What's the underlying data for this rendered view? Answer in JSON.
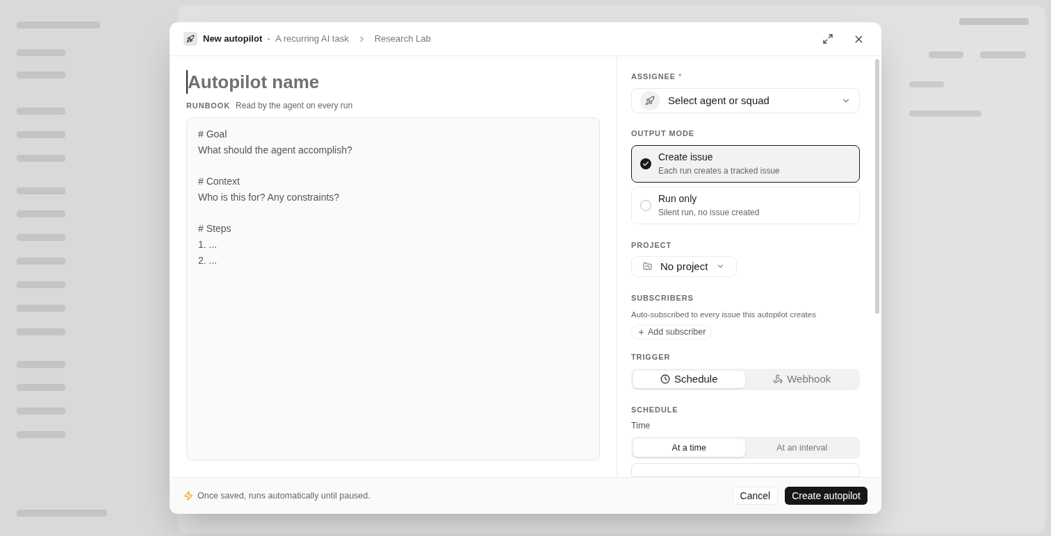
{
  "dialog": {
    "title": "New autopilot",
    "subtitle": "A recurring AI task",
    "breadcrumb": "Research Lab"
  },
  "name_field": {
    "placeholder": "Autopilot name"
  },
  "runbook": {
    "label": "RUNBOOK",
    "hint": "Read by the agent on every run",
    "placeholder": "# Goal\nWhat should the agent accomplish?\n\n# Context\nWho is this for? Any constraints?\n\n# Steps\n1. ...\n2. ..."
  },
  "assignee": {
    "label": "ASSIGNEE",
    "required_mark": "*",
    "placeholder": "Select agent or squad"
  },
  "output_mode": {
    "label": "OUTPUT MODE",
    "options": [
      {
        "title": "Create issue",
        "description": "Each run creates a tracked issue",
        "selected": true
      },
      {
        "title": "Run only",
        "description": "Silent run, no issue created",
        "selected": false
      }
    ]
  },
  "project": {
    "label": "PROJECT",
    "value": "No project"
  },
  "subscribers": {
    "label": "SUBSCRIBERS",
    "description": "Auto-subscribed to every issue this autopilot creates",
    "add_button": "Add subscriber"
  },
  "trigger": {
    "label": "TRIGGER",
    "options": [
      {
        "label": "Schedule",
        "kind": "clock",
        "selected": true
      },
      {
        "label": "Webhook",
        "kind": "webhook",
        "selected": false
      }
    ]
  },
  "schedule": {
    "label": "SCHEDULE",
    "time_label": "Time",
    "options": [
      {
        "label": "At a time",
        "selected": true
      },
      {
        "label": "At an interval",
        "selected": false
      }
    ]
  },
  "footer": {
    "note": "Once saved, runs automatically until paused.",
    "cancel": "Cancel",
    "submit": "Create autopilot"
  }
}
